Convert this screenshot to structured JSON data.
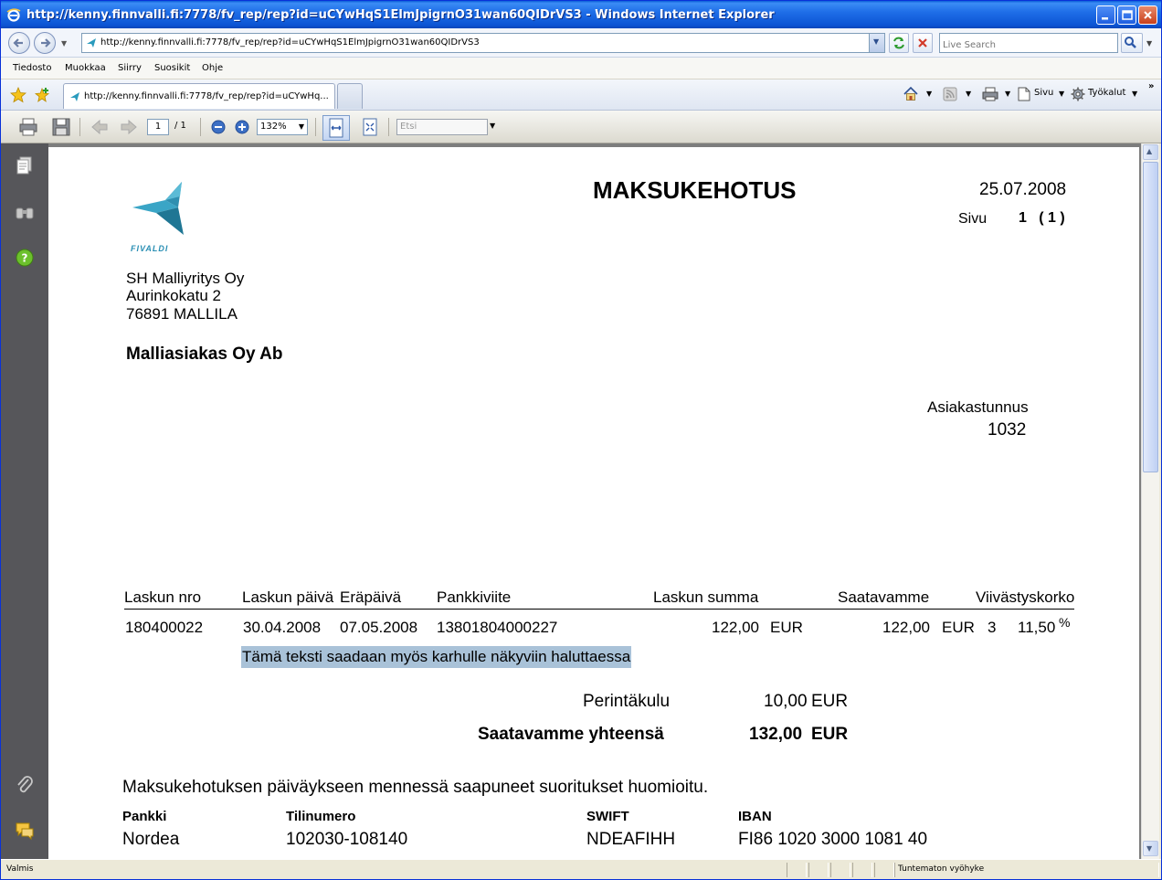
{
  "window": {
    "title": "http://kenny.finnvalli.fi:7778/fv_rep/rep?id=uCYwHqS1ElmJpigrnO31wan60QIDrVS3 - Windows Internet Explorer"
  },
  "address_bar": {
    "url": "http://kenny.finnvalli.fi:7778/fv_rep/rep?id=uCYwHqS1ElmJpigrnO31wan60QIDrVS3",
    "search_placeholder": "Live Search"
  },
  "menu": {
    "items": [
      "Tiedosto",
      "Muokkaa",
      "Siirry",
      "Suosikit",
      "Ohje"
    ]
  },
  "tabs": {
    "active_label": "http://kenny.finnvalli.fi:7778/fv_rep/rep?id=uCYwHq..."
  },
  "command_bar": {
    "page_label": "Sivu",
    "tools_label": "Työkalut"
  },
  "pdf_toolbar": {
    "current_page": "1",
    "total_pages": "/ 1",
    "zoom": "132%",
    "find_placeholder": "Etsi"
  },
  "document": {
    "heading": "MAKSUKEHOTUS",
    "date": "25.07.2008",
    "page_label": "Sivu",
    "page_value": "1   ( 1 )",
    "logo_text": "FIVALDI",
    "sender": {
      "name": "SH Malliyritys Oy",
      "street": "Aurinkokatu 2",
      "city": "76891 MALLILA"
    },
    "recipient": "Malliasiakas Oy Ab",
    "customer_id_label": "Asiakastunnus",
    "customer_id": "1032",
    "table_headers": {
      "invoice_no": "Laskun nro",
      "invoice_date": "Laskun päivä",
      "due_date": "Eräpäivä",
      "reference": "Pankkiviite",
      "invoice_sum": "Laskun summa",
      "receivable": "Saatavamme",
      "late_interest": "Viivästyskorko"
    },
    "row": {
      "invoice_no": "180400022",
      "invoice_date": "30.04.2008",
      "due_date": "07.05.2008",
      "reference": "13801804000227",
      "invoice_sum": "122,00",
      "invoice_currency": "EUR",
      "receivable": "122,00",
      "receivable_currency": "EUR",
      "days": "3",
      "interest": "11,50",
      "interest_unit": "%"
    },
    "note": "Tämä teksti saadaan myös karhulle näkyviin haluttaessa",
    "collection_fee_label": "Perintäkulu",
    "collection_fee": "10,00",
    "collection_fee_currency": "EUR",
    "total_label": "Saatavamme yhteensä",
    "total": "132,00",
    "total_currency": "EUR",
    "payment_note": "Maksukehotuksen päiväykseen mennessä saapuneet suoritukset huomioitu.",
    "bank_headers": {
      "bank": "Pankki",
      "account": "Tilinumero",
      "swift": "SWIFT",
      "iban": "IBAN"
    },
    "bank": {
      "bank": "Nordea",
      "account": "102030-108140",
      "swift": "NDEAFIHH",
      "iban": "FI86 1020 3000 1081 40"
    }
  },
  "status_bar": {
    "status": "Valmis",
    "zone": "Tuntematon vyöhyke"
  },
  "colors": {
    "titlebar": "#1f6ee8",
    "highlight": "#a9c2d8",
    "logo": "#2a9bbd",
    "nav_pane": "#56565a"
  }
}
